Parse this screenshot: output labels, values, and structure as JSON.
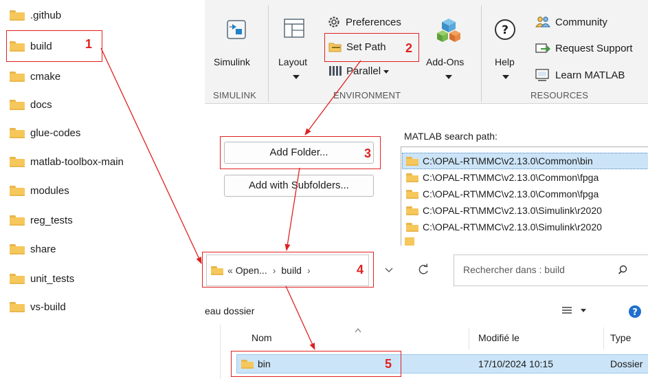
{
  "tree": {
    "items": [
      ".github",
      "build",
      "cmake",
      "docs",
      "glue-codes",
      "matlab-toolbox-main",
      "modules",
      "reg_tests",
      "share",
      "unit_tests",
      "vs-build"
    ]
  },
  "ribbon": {
    "simulink_label": "Simulink",
    "simulink_group": "SIMULINK",
    "layout_label": "Layout",
    "preferences_label": "Preferences",
    "set_path_label": "Set Path",
    "parallel_label": "Parallel",
    "addons_label": "Add-Ons",
    "environment_group": "ENVIRONMENT",
    "help_label": "Help",
    "community_label": "Community",
    "request_support_label": "Request Support",
    "learn_matlab_label": "Learn MATLAB",
    "resources_group": "RESOURCES"
  },
  "setpath": {
    "add_folder_label": "Add Folder...",
    "add_subfolders_label": "Add with Subfolders...",
    "search_path_label": "MATLAB search path:",
    "paths": [
      "C:\\OPAL-RT\\MMC\\v2.13.0\\Common\\bin",
      "C:\\OPAL-RT\\MMC\\v2.13.0\\Common\\fpga",
      "C:\\OPAL-RT\\MMC\\v2.13.0\\Common\\fpga",
      "C:\\OPAL-RT\\MMC\\v2.13.0\\Simulink\\r2020",
      "C:\\OPAL-RT\\MMC\\v2.13.0\\Simulink\\r2020"
    ]
  },
  "explorer": {
    "crumb_prefix": "«",
    "crumb_open": "Open...",
    "crumb_sep1": "›",
    "crumb_build": "build",
    "crumb_sep2": "›",
    "search_placeholder": "Rechercher dans : build",
    "new_folder_label": "eau dossier",
    "col_name": "Nom",
    "col_modified": "Modifié le",
    "col_type": "Type",
    "row_name": "bin",
    "row_modified": "17/10/2024 10:15",
    "row_type": "Dossier"
  },
  "annotations": {
    "n1": "1",
    "n2": "2",
    "n3": "3",
    "n4": "4",
    "n5": "5"
  },
  "colors": {
    "annotation_red": "#e02020",
    "selection_blue": "#cce4f7",
    "folder_yellow": "#f6c75a"
  }
}
